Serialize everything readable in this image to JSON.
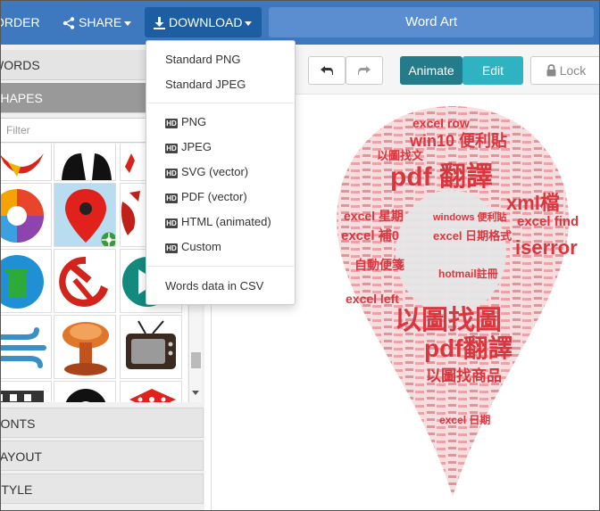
{
  "topbar": {
    "order_label": "ORDER",
    "share_label": "SHARE",
    "download_label": "DOWNLOAD",
    "title": "Word Art"
  },
  "left_panel": {
    "words_label": "WORDS",
    "shapes_label": "SHAPES",
    "filter_placeholder": "Filter",
    "fonts_label": "FONTS",
    "layout_label": "LAYOUT",
    "style_label": "STYLE"
  },
  "toolbar": {
    "animate_label": "Animate",
    "edit_label": "Edit",
    "lock_label": "Lock"
  },
  "download_menu": {
    "items": [
      {
        "label": "Standard PNG",
        "hd": false
      },
      {
        "label": "Standard JPEG",
        "hd": false
      },
      {
        "label": "PNG",
        "hd": true
      },
      {
        "label": "JPEG",
        "hd": true
      },
      {
        "label": "SVG (vector)",
        "hd": true
      },
      {
        "label": "PDF (vector)",
        "hd": true
      },
      {
        "label": "HTML (animated)",
        "hd": true
      },
      {
        "label": "Custom",
        "hd": true
      },
      {
        "label": "Words data in CSV",
        "hd": false
      }
    ],
    "hd_badge": "HD"
  },
  "word_cloud": {
    "words": [
      {
        "text": "excel row",
        "color": "#d9363e"
      },
      {
        "text": "win10 便利貼",
        "color": "#d9363e"
      },
      {
        "text": "以圖找文",
        "color": "#d9363e"
      },
      {
        "text": "pdf 翻譯",
        "color": "#d9363e"
      },
      {
        "text": "xml檔",
        "color": "#d9363e"
      },
      {
        "text": "excel 星期",
        "color": "#d9363e"
      },
      {
        "text": "windows 便利貼",
        "color": "#d9363e"
      },
      {
        "text": "excel find",
        "color": "#d9363e"
      },
      {
        "text": "excel 補0",
        "color": "#d9363e"
      },
      {
        "text": "excel 日期格式",
        "color": "#d9363e"
      },
      {
        "text": "iserror",
        "color": "#d9363e"
      },
      {
        "text": "自動便箋",
        "color": "#d9363e"
      },
      {
        "text": "hotmail註冊",
        "color": "#d9363e"
      },
      {
        "text": "excel left",
        "color": "#d9363e"
      },
      {
        "text": "以圖找圖",
        "color": "#d9363e"
      },
      {
        "text": "pdf翻譯",
        "color": "#d9363e"
      },
      {
        "text": "以圖找商品",
        "color": "#d9363e"
      },
      {
        "text": "excel 日期",
        "color": "#d9363e"
      }
    ]
  }
}
